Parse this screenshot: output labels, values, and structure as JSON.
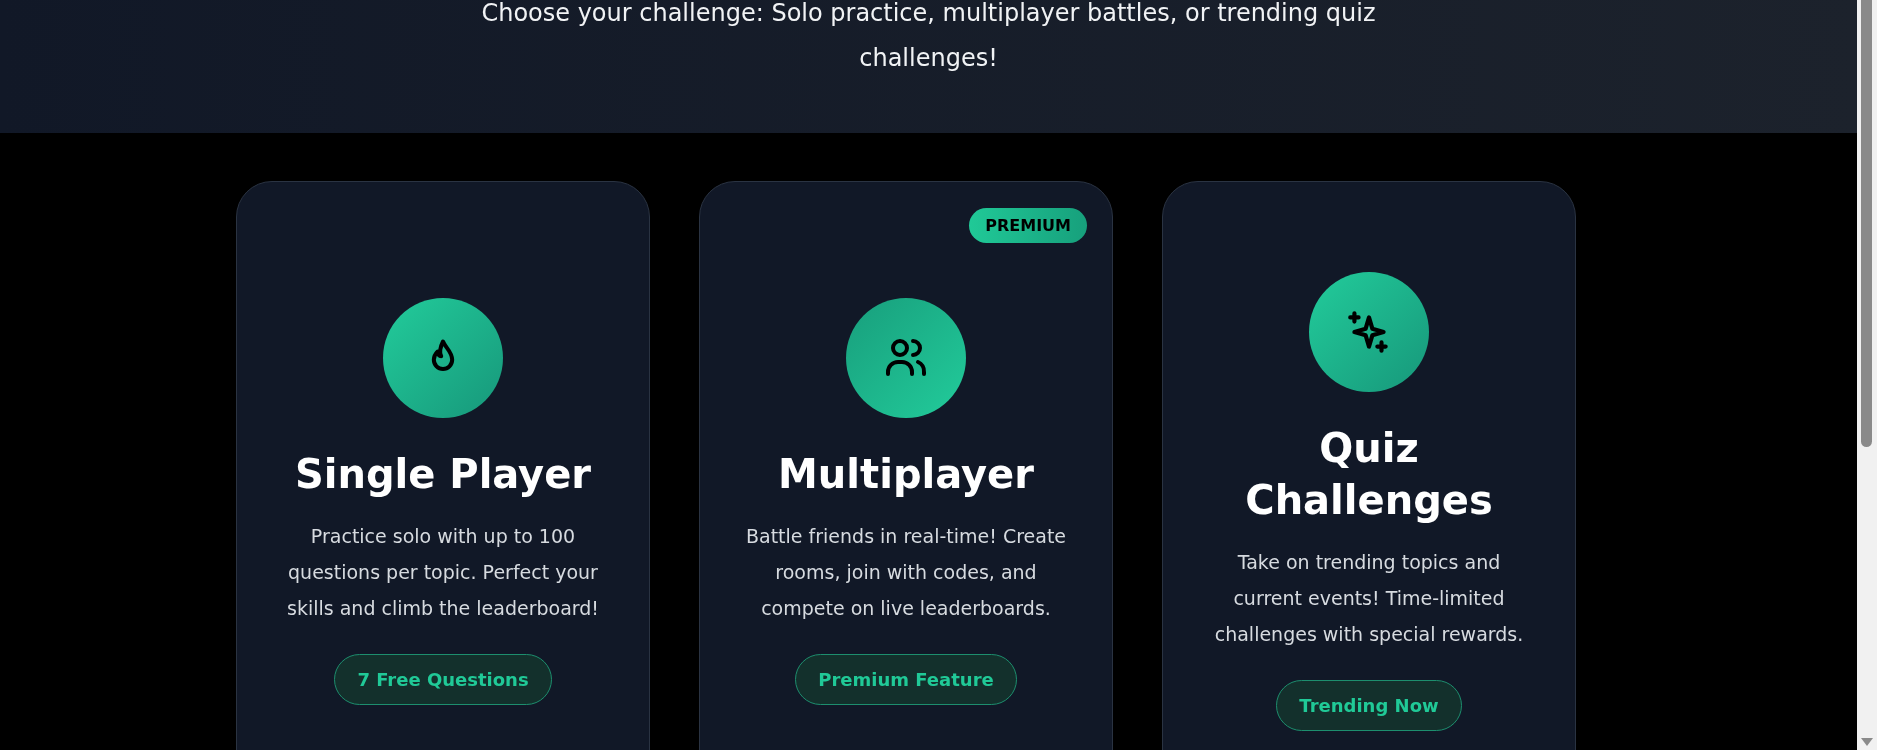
{
  "header": {
    "subtitle": "Choose your challenge: Solo practice, multiplayer battles, or trending quiz challenges!"
  },
  "cards": [
    {
      "title": "Single Player",
      "description": "Practice solo with up to 100 questions per topic. Perfect your skills and climb the leaderboard!",
      "button": "7 Free Questions"
    },
    {
      "title": "Multiplayer",
      "badge": "PREMIUM",
      "description": "Battle friends in real-time! Create rooms, join with codes, and compete on live leaderboards.",
      "button": "Premium Feature"
    },
    {
      "title": "Quiz Challenges",
      "description": "Take on trending topics and current events! Time-limited challenges with special rewards.",
      "button": "Trending Now"
    }
  ]
}
